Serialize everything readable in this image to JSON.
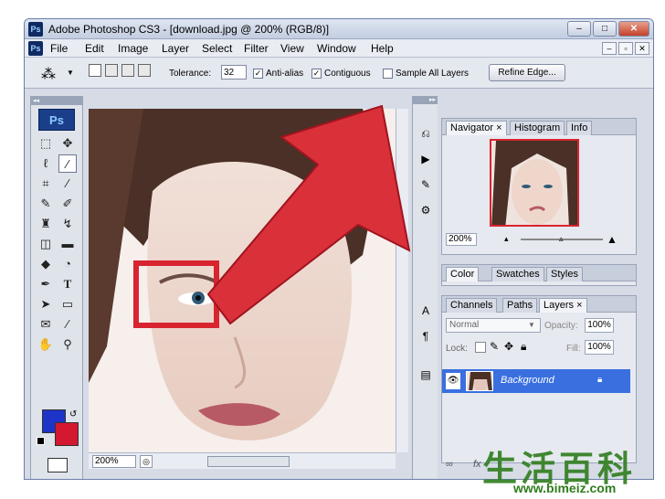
{
  "window": {
    "title": "Adobe Photoshop CS3 - [download.jpg @ 200% (RGB/8)]",
    "app_icon": "Ps",
    "minimize": "–",
    "maximize": "□",
    "close": "✕"
  },
  "menubar": {
    "items": [
      "File",
      "Edit",
      "Image",
      "Layer",
      "Select",
      "Filter",
      "View",
      "Window",
      "Help"
    ],
    "doc_buttons": [
      "–",
      "▫",
      "✕"
    ]
  },
  "options": {
    "tolerance_label": "Tolerance:",
    "tolerance_value": "32",
    "antialias_label": "Anti-alias",
    "antialias_checked": true,
    "contiguous_label": "Contiguous",
    "contiguous_checked": true,
    "sample_all_label": "Sample All Layers",
    "sample_all_checked": false,
    "refine_edge": "Refine Edge..."
  },
  "toolbox": {
    "logo": "Ps",
    "fg_color": "#1e34c8",
    "bg_color": "#d31830"
  },
  "status": {
    "zoom": "200%"
  },
  "navigator": {
    "tabs": [
      "Navigator",
      "Histogram",
      "Info"
    ],
    "zoom": "200%"
  },
  "color_panel": {
    "tabs": [
      "Color",
      "Swatches",
      "Styles"
    ]
  },
  "layers_panel": {
    "tabs": [
      "Channels",
      "Paths",
      "Layers"
    ],
    "blend_mode": "Normal",
    "opacity_label": "Opacity:",
    "opacity_value": "100%",
    "lock_label": "Lock:",
    "fill_label": "Fill:",
    "fill_value": "100%",
    "layer_name": "Background"
  },
  "watermark": {
    "chinese": "生活百科",
    "url": "www.bimeiz.com"
  },
  "colors": {
    "arrow": "#d9303a",
    "highlight_box": "#d8242f",
    "selected_layer": "#3a6fe0"
  }
}
